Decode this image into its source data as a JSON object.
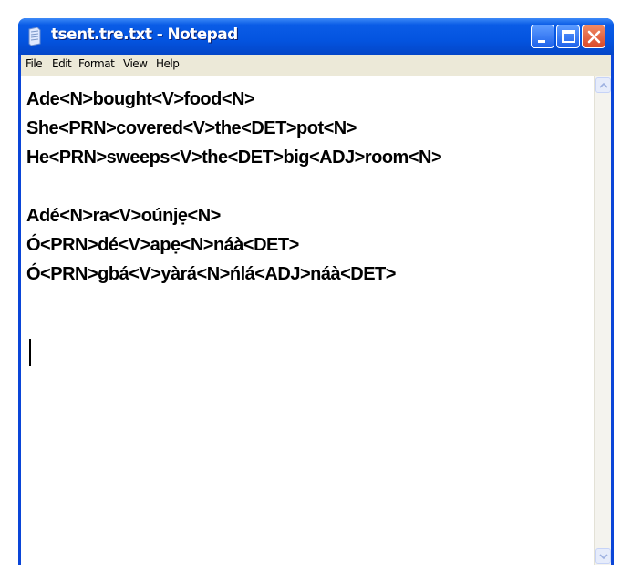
{
  "window": {
    "title": "tsent.tre.txt - Notepad",
    "accent": "#0a45d8"
  },
  "controls": {
    "minimize": "minimize-icon",
    "maximize": "maximize-icon",
    "close": "close-icon"
  },
  "menu": [
    "File",
    "Edit",
    "Format",
    "View",
    "Help"
  ],
  "document": {
    "lines": [
      "Ade<N>bought<V>food<N>",
      "She<PRN>covered<V>the<DET>pot<N>",
      "He<PRN>sweeps<V>the<DET>big<ADJ>room<N>",
      "",
      "Adé<N>ra<V>oúnjẹ<N>",
      "Ó<PRN>dé<V>apẹ<N>náà<DET>",
      "Ó<PRN>gbá<V>yàrá<N>ńlá<ADJ>náà<DET>"
    ]
  }
}
